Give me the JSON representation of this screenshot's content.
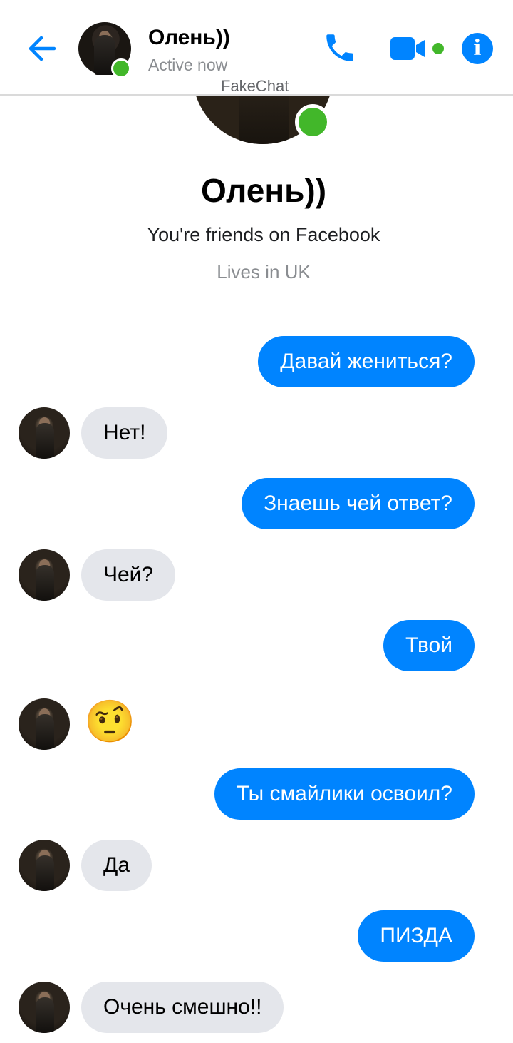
{
  "header": {
    "name": "Олень))",
    "status": "Active now",
    "watermark": "FakeChat",
    "icons": {
      "back": "arrow-left-icon",
      "call": "phone-icon",
      "video": "video-camera-icon",
      "info": "info-icon"
    },
    "info_glyph": "i"
  },
  "profile": {
    "name": "Олень))",
    "friends_note": "You're friends on Facebook",
    "lives": "Lives in UK"
  },
  "messages": [
    {
      "dir": "out",
      "text": "Давай жениться?"
    },
    {
      "dir": "in",
      "text": "Нет!"
    },
    {
      "dir": "out",
      "text": "Знаешь чей ответ?"
    },
    {
      "dir": "in",
      "text": "Чей?"
    },
    {
      "dir": "out",
      "text": "Твой"
    },
    {
      "dir": "in",
      "text": "🤨"
    },
    {
      "dir": "out",
      "text": "Ты смайлики освоил?"
    },
    {
      "dir": "in",
      "text": "Да"
    },
    {
      "dir": "out",
      "text": "ПИЗДА"
    },
    {
      "dir": "in",
      "text": "Очень смешно!!"
    }
  ],
  "colors": {
    "accent": "#0084ff",
    "online": "#42b72a",
    "incoming_bubble": "#e4e6eb",
    "secondary_text": "#8a8d91"
  }
}
